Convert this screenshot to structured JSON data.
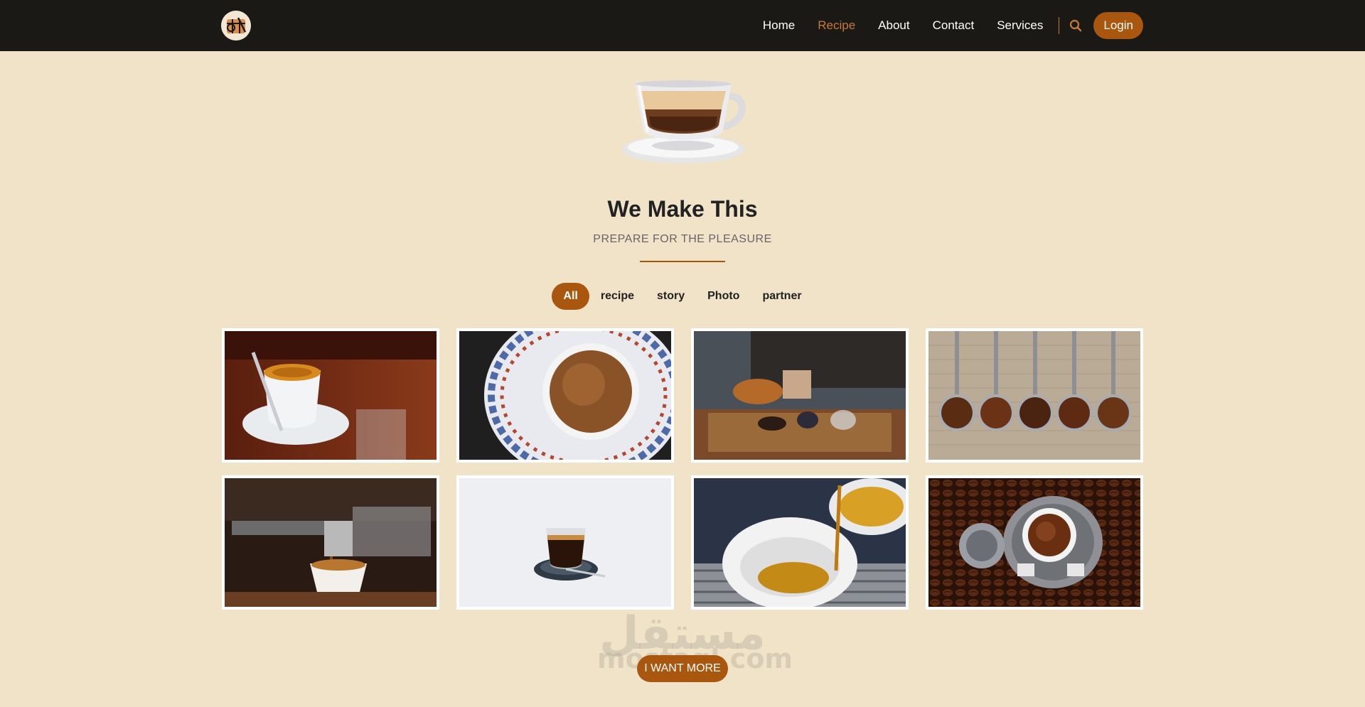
{
  "nav": {
    "items": [
      {
        "label": "Home",
        "active": false
      },
      {
        "label": "Recipe",
        "active": true
      },
      {
        "label": "About",
        "active": false
      },
      {
        "label": "Contact",
        "active": false
      },
      {
        "label": "Services",
        "active": false
      }
    ],
    "search_icon": "search-icon",
    "login_label": "Login"
  },
  "hero": {
    "title": "We Make This",
    "subtitle": "PREPARE FOR THE PLEASURE"
  },
  "filters": [
    {
      "label": "All",
      "active": true
    },
    {
      "label": "recipe",
      "active": false
    },
    {
      "label": "story",
      "active": false
    },
    {
      "label": "Photo",
      "active": false
    },
    {
      "label": "partner",
      "active": false
    }
  ],
  "gallery": [
    {
      "name": "espresso-cup-on-wood"
    },
    {
      "name": "turkish-coffee-cup-blue-pattern"
    },
    {
      "name": "pouring-coffee-from-cezve"
    },
    {
      "name": "coffee-spoons-on-burlap"
    },
    {
      "name": "espresso-machine-brewing"
    },
    {
      "name": "espresso-shot-glass-white"
    },
    {
      "name": "espresso-pouring-into-cup"
    },
    {
      "name": "coffee-cup-on-beans"
    }
  ],
  "watermark": {
    "arabic": "مستقل",
    "english": "mostaql.com"
  },
  "cta": {
    "more_label": "I WANT MORE"
  },
  "colors": {
    "accent": "#a9560f",
    "nav_active": "#c67a36",
    "page_bg": "#f0e3c8",
    "navbar_bg": "#1b1916"
  }
}
